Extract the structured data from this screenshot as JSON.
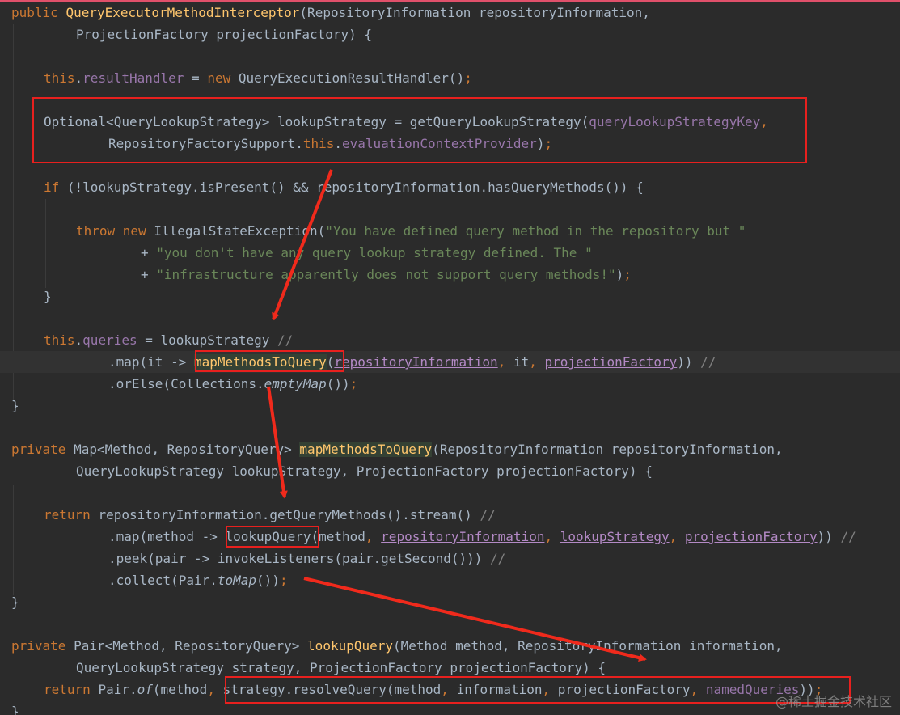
{
  "watermark": "@稀土掘金技术社区",
  "lines": [
    {
      "row": 0,
      "tokens": [
        {
          "c": "kw",
          "t": "public "
        },
        {
          "c": "fn",
          "t": "QueryExecutorMethodInterceptor"
        },
        {
          "c": "p",
          "t": "(RepositoryInformation repositoryInformation,"
        }
      ]
    },
    {
      "row": 1,
      "indent": 8,
      "tokens": [
        {
          "c": "p",
          "t": "ProjectionFactory projectionFactory) {"
        }
      ]
    },
    {
      "row": 3,
      "indent": 4,
      "tokens": [
        {
          "c": "kw",
          "t": "this"
        },
        {
          "c": "p",
          "t": "."
        },
        {
          "c": "fld",
          "t": "resultHandler"
        },
        {
          "c": "p",
          "t": " = "
        },
        {
          "c": "kw",
          "t": "new "
        },
        {
          "c": "p",
          "t": "QueryExecutionResultHandler()"
        },
        {
          "c": "kw",
          "t": ";"
        }
      ]
    },
    {
      "row": 5,
      "indent": 4,
      "tokens": [
        {
          "c": "p",
          "t": "Optional<QueryLookupStrategy> lookupStrategy = getQueryLookupStrategy("
        },
        {
          "c": "fld",
          "t": "queryLookupStrategyKey"
        },
        {
          "c": "kw",
          "t": ","
        }
      ]
    },
    {
      "row": 6,
      "indent": 12,
      "tokens": [
        {
          "c": "p",
          "t": "RepositoryFactorySupport."
        },
        {
          "c": "kw",
          "t": "this"
        },
        {
          "c": "p",
          "t": "."
        },
        {
          "c": "fld",
          "t": "evaluationContextProvider"
        },
        {
          "c": "p",
          "t": ")"
        },
        {
          "c": "kw",
          "t": ";"
        }
      ]
    },
    {
      "row": 8,
      "indent": 4,
      "tokens": [
        {
          "c": "kw",
          "t": "if "
        },
        {
          "c": "p",
          "t": "(!lookupStrategy.isPresent() && repositoryInformation.hasQueryMethods()) {"
        }
      ]
    },
    {
      "row": 10,
      "indent": 8,
      "tokens": [
        {
          "c": "kw",
          "t": "throw new "
        },
        {
          "c": "p",
          "t": "IllegalStateException("
        },
        {
          "c": "str",
          "t": "\"You have defined query method in the repository but \""
        }
      ]
    },
    {
      "row": 11,
      "indent": 16,
      "tokens": [
        {
          "c": "p",
          "t": "+ "
        },
        {
          "c": "str",
          "t": "\"you don't have any query lookup strategy defined. The \""
        }
      ]
    },
    {
      "row": 12,
      "indent": 16,
      "tokens": [
        {
          "c": "p",
          "t": "+ "
        },
        {
          "c": "str",
          "t": "\"infrastructure apparently does not support query methods!\""
        },
        {
          "c": "p",
          "t": ")"
        },
        {
          "c": "kw",
          "t": ";"
        }
      ]
    },
    {
      "row": 13,
      "indent": 4,
      "tokens": [
        {
          "c": "p",
          "t": "}"
        }
      ]
    },
    {
      "row": 15,
      "indent": 4,
      "tokens": [
        {
          "c": "kw",
          "t": "this"
        },
        {
          "c": "p",
          "t": "."
        },
        {
          "c": "fld",
          "t": "queries"
        },
        {
          "c": "p",
          "t": " = lookupStrategy "
        },
        {
          "c": "cm",
          "t": "//"
        }
      ]
    },
    {
      "row": 16,
      "indent": 12,
      "current": true,
      "tokens": [
        {
          "c": "p",
          "t": ".map(it -> "
        },
        {
          "c": "hl",
          "t": "mapMethodsToQuery"
        },
        {
          "c": "p",
          "t": "("
        },
        {
          "c": "ul",
          "t": "repositoryInformation"
        },
        {
          "c": "kw",
          "t": ", "
        },
        {
          "c": "p",
          "t": "it"
        },
        {
          "c": "kw",
          "t": ", "
        },
        {
          "c": "ul",
          "t": "projectionFactory"
        },
        {
          "c": "p",
          "t": ")) "
        },
        {
          "c": "cm",
          "t": "//"
        }
      ]
    },
    {
      "row": 17,
      "indent": 12,
      "tokens": [
        {
          "c": "p",
          "t": ".orElse(Collections."
        },
        {
          "c": "it",
          "t": "emptyMap"
        },
        {
          "c": "p",
          "t": "())"
        },
        {
          "c": "kw",
          "t": ";"
        }
      ]
    },
    {
      "row": 18,
      "tokens": [
        {
          "c": "p",
          "t": "}"
        }
      ]
    },
    {
      "row": 20,
      "tokens": [
        {
          "c": "kw",
          "t": "private "
        },
        {
          "c": "p",
          "t": "Map<Method, RepositoryQuery> "
        },
        {
          "c": "hl",
          "t": "mapMethodsToQuery"
        },
        {
          "c": "p",
          "t": "(RepositoryInformation repositoryInformation,"
        }
      ]
    },
    {
      "row": 21,
      "indent": 8,
      "tokens": [
        {
          "c": "p",
          "t": "QueryLookupStrategy lookupStrategy, ProjectionFactory projectionFactory) {"
        }
      ]
    },
    {
      "row": 23,
      "indent": 4,
      "tokens": [
        {
          "c": "kw",
          "t": "return "
        },
        {
          "c": "p",
          "t": "repositoryInformation.getQueryMethods().stream() "
        },
        {
          "c": "cm",
          "t": "//"
        }
      ]
    },
    {
      "row": 24,
      "indent": 12,
      "tokens": [
        {
          "c": "p",
          "t": ".map(method -> "
        },
        {
          "c": "p",
          "t": "lookupQuery"
        },
        {
          "c": "p",
          "t": "(method"
        },
        {
          "c": "kw",
          "t": ", "
        },
        {
          "c": "ul",
          "t": "repositoryInformation"
        },
        {
          "c": "kw",
          "t": ", "
        },
        {
          "c": "ul",
          "t": "lookupStrategy"
        },
        {
          "c": "kw",
          "t": ", "
        },
        {
          "c": "ul",
          "t": "projectionFactory"
        },
        {
          "c": "p",
          "t": ")) "
        },
        {
          "c": "cm",
          "t": "//"
        }
      ]
    },
    {
      "row": 25,
      "indent": 12,
      "tokens": [
        {
          "c": "p",
          "t": ".peek(pair -> invokeListeners(pair.getSecond())) "
        },
        {
          "c": "cm",
          "t": "//"
        }
      ]
    },
    {
      "row": 26,
      "indent": 12,
      "tokens": [
        {
          "c": "p",
          "t": ".collect(Pair."
        },
        {
          "c": "it",
          "t": "toMap"
        },
        {
          "c": "p",
          "t": "())"
        },
        {
          "c": "kw",
          "t": ";"
        }
      ]
    },
    {
      "row": 27,
      "tokens": [
        {
          "c": "p",
          "t": "}"
        }
      ]
    },
    {
      "row": 29,
      "tokens": [
        {
          "c": "kw",
          "t": "private "
        },
        {
          "c": "p",
          "t": "Pair<Method, RepositoryQuery> "
        },
        {
          "c": "fn",
          "t": "lookupQuery"
        },
        {
          "c": "p",
          "t": "(Method method, RepositoryInformation information,"
        }
      ]
    },
    {
      "row": 30,
      "indent": 8,
      "tokens": [
        {
          "c": "p",
          "t": "QueryLookupStrategy strategy, ProjectionFactory projectionFactory) {"
        }
      ]
    },
    {
      "row": 31,
      "indent": 4,
      "tokens": [
        {
          "c": "kw",
          "t": "return "
        },
        {
          "c": "p",
          "t": "Pair."
        },
        {
          "c": "it",
          "t": "of"
        },
        {
          "c": "p",
          "t": "(method"
        },
        {
          "c": "kw",
          "t": ", "
        },
        {
          "c": "p",
          "t": "strategy.resolveQuery(method"
        },
        {
          "c": "kw",
          "t": ", "
        },
        {
          "c": "p",
          "t": "information"
        },
        {
          "c": "kw",
          "t": ", "
        },
        {
          "c": "p",
          "t": "projectionFactory"
        },
        {
          "c": "kw",
          "t": ", "
        },
        {
          "c": "fld",
          "t": "namedQueries"
        },
        {
          "c": "p",
          "t": "))"
        },
        {
          "c": "kw",
          "t": ";"
        }
      ]
    },
    {
      "row": 32,
      "tokens": [
        {
          "c": "p",
          "t": "}"
        }
      ]
    }
  ]
}
